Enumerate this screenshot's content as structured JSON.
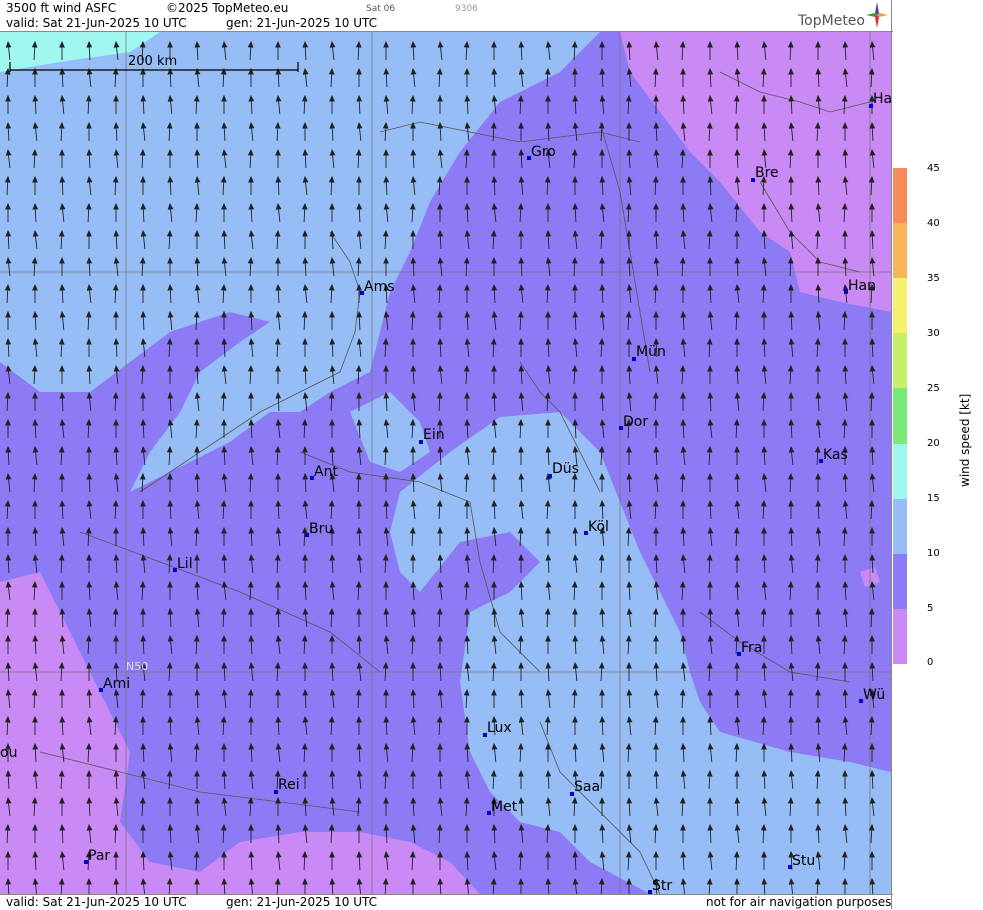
{
  "header": {
    "title": "3500 ft wind ASFC",
    "copyright": "©2025 TopMeteo.eu",
    "day_code": "Sat 06",
    "code_number": "9306",
    "valid": "valid:  Sat  21-Jun-2025  10 UTC",
    "generated": "gen:  21-Jun-2025 10 UTC"
  },
  "logo": {
    "text": "TopMeteo",
    "icon": "compass-star-icon"
  },
  "scale_bar": {
    "label": "200 km"
  },
  "grid_label": "N50",
  "cities": [
    {
      "label": "Ha"
    },
    {
      "label": "Gro"
    },
    {
      "label": "Bre"
    },
    {
      "label": "Ams"
    },
    {
      "label": "Han"
    },
    {
      "label": "Mün"
    },
    {
      "label": "Ein"
    },
    {
      "label": "Dor"
    },
    {
      "label": "Kas"
    },
    {
      "label": "Ant"
    },
    {
      "label": "Düs"
    },
    {
      "label": "Köl"
    },
    {
      "label": "Bru"
    },
    {
      "label": "Lil"
    },
    {
      "label": "Fra"
    },
    {
      "label": "Ami"
    },
    {
      "label": "Wü"
    },
    {
      "label": "Lux"
    },
    {
      "label": "ou"
    },
    {
      "label": "Rei"
    },
    {
      "label": "Saa"
    },
    {
      "label": "Met"
    },
    {
      "label": "Par"
    },
    {
      "label": "Stu"
    },
    {
      "label": "Str"
    }
  ],
  "legend": {
    "title": "wind  speed  [kt]",
    "ticks": [
      "45",
      "40",
      "35",
      "30",
      "25",
      "20",
      "15",
      "10",
      "5",
      "0"
    ],
    "colors": [
      "#c98af5",
      "#8d7af5",
      "#96bdf6",
      "#9ff7ef",
      "#7be878",
      "#c6ef6a",
      "#f6f070",
      "#f8b45a",
      "#f68a5a"
    ]
  },
  "footer": {
    "valid": "valid:  Sat  21-Jun-2025  10 UTC",
    "generated": "gen:  21-Jun-2025 10 UTC",
    "disclaimer": "not for air navigation purposes"
  },
  "colors": {
    "speed_0_5": "#c98af5",
    "speed_5_10": "#8d7af5",
    "speed_10_15": "#96bdf6",
    "speed_15_20": "#9ff7ef"
  }
}
